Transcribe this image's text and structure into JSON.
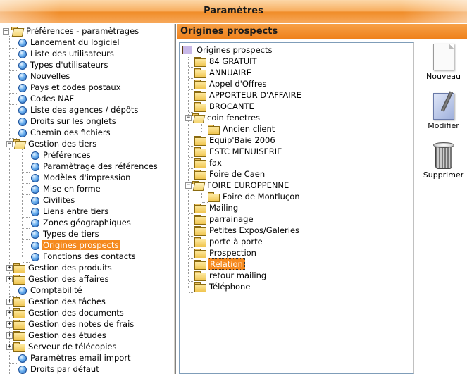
{
  "window": {
    "title": "Paramètres"
  },
  "left_tree": {
    "root_label": "Préférences - paramètrages",
    "items": [
      {
        "label": "Lancement du logiciel"
      },
      {
        "label": "Liste des utilisateurs"
      },
      {
        "label": "Types d'utilisateurs"
      },
      {
        "label": "Nouvelles"
      },
      {
        "label": "Pays et codes postaux"
      },
      {
        "label": "Codes NAF"
      },
      {
        "label": "Liste des agences / dépôts"
      },
      {
        "label": "Droits sur les onglets"
      },
      {
        "label": "Chemin des fichiers"
      },
      {
        "label": "Gestion des tiers"
      },
      {
        "label": "Préférences"
      },
      {
        "label": "Paramètrage des références"
      },
      {
        "label": "Modèles d'impression"
      },
      {
        "label": "Mise en forme"
      },
      {
        "label": "Civilites"
      },
      {
        "label": "Liens entre tiers"
      },
      {
        "label": "Zones géographiques"
      },
      {
        "label": "Types de tiers"
      },
      {
        "label": "Origines prospects"
      },
      {
        "label": "Fonctions des contacts"
      },
      {
        "label": "Gestion des produits"
      },
      {
        "label": "Gestion des affaires"
      },
      {
        "label": "Comptabilité"
      },
      {
        "label": "Gestion des tâches"
      },
      {
        "label": "Gestion des documents"
      },
      {
        "label": "Gestion des notes de frais"
      },
      {
        "label": "Gestion des études"
      },
      {
        "label": "Serveur de télécopies"
      },
      {
        "label": "Paramètres email import"
      },
      {
        "label": "Droits par défaut"
      }
    ]
  },
  "panel": {
    "title": "Origines prospects",
    "tree_root": "Origines prospects",
    "items": [
      {
        "label": "84 GRATUIT"
      },
      {
        "label": "ANNUAIRE"
      },
      {
        "label": "Appel d'Offres"
      },
      {
        "label": "APPORTEUR D'AFFAIRE"
      },
      {
        "label": "BROCANTE"
      },
      {
        "label": "coin fenetres"
      },
      {
        "label": "Ancien client"
      },
      {
        "label": "Equip'Baie 2006"
      },
      {
        "label": "ESTC MENUISERIE"
      },
      {
        "label": "fax"
      },
      {
        "label": "Foire de Caen"
      },
      {
        "label": "FOIRE EUROPPENNE"
      },
      {
        "label": "Foire de Montluçon"
      },
      {
        "label": "Mailing"
      },
      {
        "label": "parrainage"
      },
      {
        "label": "Petites Expos/Galeries"
      },
      {
        "label": "porte à porte"
      },
      {
        "label": "Prospection"
      },
      {
        "label": "Relation"
      },
      {
        "label": "retour mailing"
      },
      {
        "label": "Téléphone"
      }
    ]
  },
  "toolbar": {
    "new_label": "Nouveau",
    "edit_label": "Modifier",
    "delete_label": "Supprimer"
  },
  "colors": {
    "accent": "#f58a1f",
    "selection": "#f58a1f"
  }
}
